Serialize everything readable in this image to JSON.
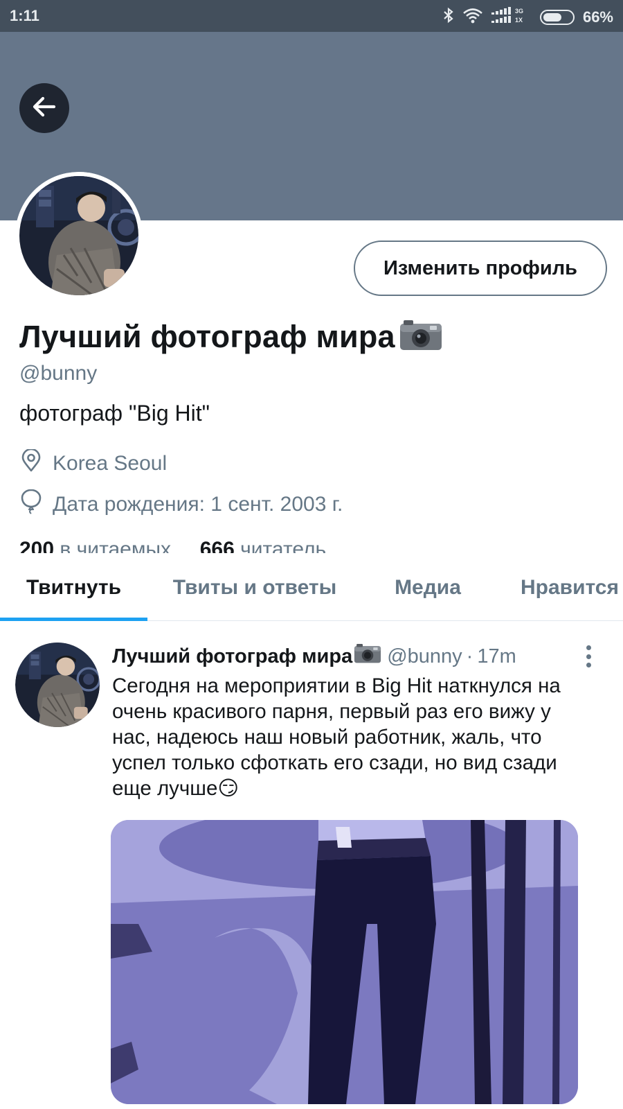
{
  "status_bar": {
    "time": "1:11",
    "network_top": "3G",
    "network_bottom": "1X",
    "battery_percent": "66%",
    "battery_level": 0.66,
    "icons": [
      "bluetooth-icon",
      "wifi-icon",
      "signal-icon",
      "battery-icon"
    ]
  },
  "header": {
    "banner_color": "#66768a",
    "back_icon": "arrow-left-icon"
  },
  "profile": {
    "display_name": "Лучший фотограф мира",
    "handle": "@bunny",
    "bio": "фотограф \"Big Hit\"",
    "location": "Korea Seoul",
    "birthday": "Дата рождения: 1 сент. 2003 г.",
    "following_count": "200",
    "following_label": "в читаемых",
    "followers_count": "666",
    "followers_label": "читатель",
    "edit_button_label": "Изменить профиль"
  },
  "tabs": [
    {
      "label": "Твитнуть",
      "active": true
    },
    {
      "label": "Твиты и ответы",
      "active": false
    },
    {
      "label": "Медиа",
      "active": false
    },
    {
      "label": "Нравится",
      "active": false
    }
  ],
  "tweet": {
    "author_name": "Лучший фотограф мира",
    "author_handle": "@bunny",
    "separator": "·",
    "time": "17m",
    "text": "Сегодня на мероприятии в Big Hit наткнулся на очень красивого парня, первый раз его вижу у нас, надеюсь наш новый работник, жаль, что успел только сфоткать его сзади, но вид сзади еще лучше😏"
  },
  "colors": {
    "accent": "#1da1f2",
    "status_bar": "#434f5c",
    "secondary_text": "#657786",
    "primary_text": "#14171a"
  }
}
